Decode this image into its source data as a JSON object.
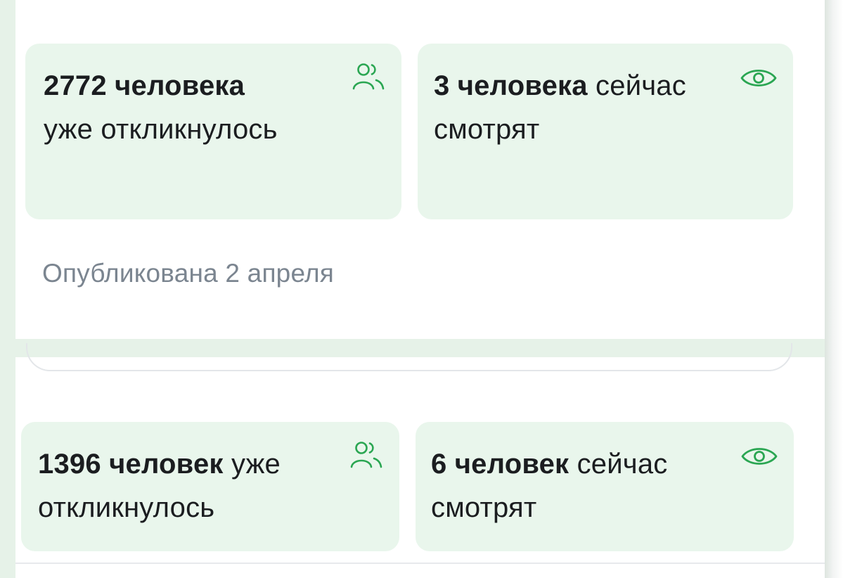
{
  "vacancy_top": {
    "responses": {
      "count": "2772 человека",
      "text": "уже откликнулось",
      "icon": "people-icon"
    },
    "viewers": {
      "count": "3 человека",
      "text": "сейчас смотрят",
      "icon": "eye-icon"
    },
    "published": "Опубликована 2 апреля"
  },
  "vacancy_bottom": {
    "responses": {
      "count": "1396 человек",
      "text": "уже откликнулось",
      "icon": "people-icon"
    },
    "viewers": {
      "count": "6 человек",
      "text": "сейчас смотрят",
      "icon": "eye-icon"
    }
  },
  "colors": {
    "accent": "#2aa652",
    "card_bg": "#e9f6ec",
    "muted_text": "#7b8590",
    "text": "#1b1d20"
  }
}
